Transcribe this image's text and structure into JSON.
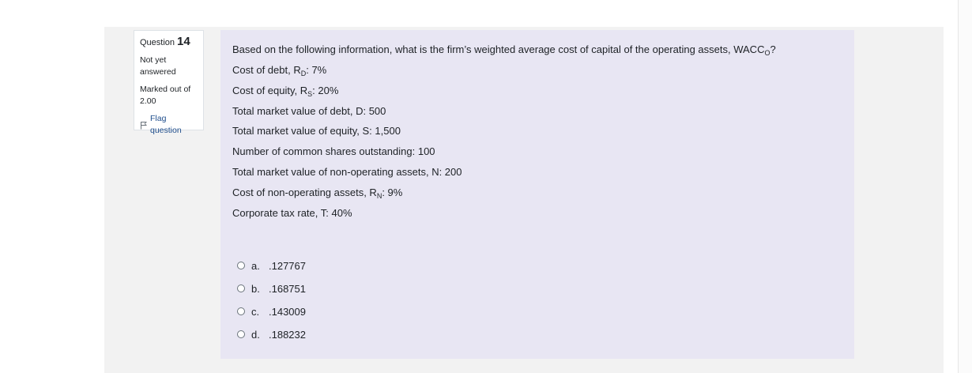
{
  "question_info": {
    "label": "Question",
    "number": "14",
    "state_line1": "Not yet",
    "state_line2": "answered",
    "grade_line1": "Marked out of",
    "grade_line2": "2.00",
    "flag_label": "Flag question",
    "flag_icon": "flag-icon"
  },
  "question": {
    "intro": "Based on the following information, what is the firm’s weighted average cost of capital of the operating assets, WACC",
    "intro_sub": "O",
    "intro_end": "?",
    "items": [
      {
        "prefix": "Cost of debt, R",
        "sub": "D",
        "suffix": ": 7%"
      },
      {
        "prefix": "Cost of equity, R",
        "sub": "S",
        "suffix": ": 20%"
      },
      {
        "prefix": "Total market value of debt, D: 500",
        "sub": "",
        "suffix": ""
      },
      {
        "prefix": "Total market value of equity, S: 1,500",
        "sub": "",
        "suffix": ""
      },
      {
        "prefix": "Number of common shares outstanding: 100",
        "sub": "",
        "suffix": ""
      },
      {
        "prefix": "Total market value of non-operating assets, N: 200",
        "sub": "",
        "suffix": ""
      },
      {
        "prefix": "Cost of non-operating assets, R",
        "sub": "N",
        "suffix": ": 9%"
      },
      {
        "prefix": "Corporate tax rate, T: 40%",
        "sub": "",
        "suffix": ""
      }
    ]
  },
  "answers": [
    {
      "letter": "a.",
      "value": ".127767"
    },
    {
      "letter": "b.",
      "value": ".168751"
    },
    {
      "letter": "c.",
      "value": ".143009"
    },
    {
      "letter": "d.",
      "value": ".188232"
    }
  ],
  "colors": {
    "page_bg": "#f2f2f2",
    "formulation_bg": "#e8e6f3",
    "flag_link": "#1f4e8c"
  }
}
